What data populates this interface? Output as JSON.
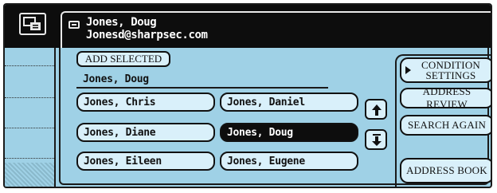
{
  "header": {
    "name": "Jones, Doug",
    "email": "Jonesd@sharpsec.com",
    "icon": "address-card-icon"
  },
  "main": {
    "add_selected_label": "ADD SELECTED",
    "selected_name": "Jones, Doug",
    "entries": [
      {
        "label": "Jones, Chris",
        "selected": false
      },
      {
        "label": "Jones, Daniel",
        "selected": false
      },
      {
        "label": "Jones, Diane",
        "selected": false
      },
      {
        "label": "Jones, Doug",
        "selected": true
      },
      {
        "label": "Jones, Eileen",
        "selected": false
      },
      {
        "label": "Jones, Eugene",
        "selected": false
      }
    ]
  },
  "side": {
    "condition_settings_line1": "CONDITION",
    "condition_settings_line2": "SETTINGS",
    "address_review": "ADDRESS REVIEW",
    "search_again": "SEARCH AGAIN",
    "address_book": "ADDRESS BOOK"
  },
  "colors": {
    "panel_blue": "#9fd1e6",
    "button_fill": "#d9f0fa",
    "header_black": "#0d0d0d"
  }
}
